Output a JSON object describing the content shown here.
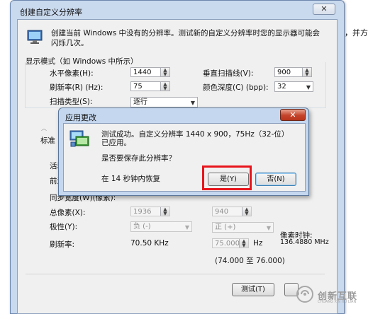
{
  "outer_window": {
    "title": "创建自定义分辨率",
    "close_label": "✕",
    "intro": "创建当前 Windows 中没有的分辨率。测试新的自定义分辨率时您的显示器可能会闪烁几次。",
    "display_mode_group": "显示模式（如 Windows 中所示）",
    "horizontal_pixels_label": "水平像素(H):",
    "horizontal_pixels_value": "1440",
    "vertical_lines_label": "垂直扫描线(V):",
    "vertical_lines_value": "900",
    "refresh_label": "刷新率(R) (Hz):",
    "refresh_value": "75",
    "color_depth_label": "颜色深度(C) (bpp):",
    "color_depth_value": "32",
    "scan_type_label": "扫描类型(S):",
    "scan_type_value": "逐行",
    "cut_left_1": "标准",
    "cut_left_2": "活动",
    "cut_left_3": "前沿",
    "cut_left_4": "同步宽度(W)(像素):",
    "total_pixels_label": "总像素(X):",
    "total_pixels_h": "1936",
    "total_pixels_v": "940",
    "polarity_label": "极性(Y):",
    "polarity_h": "负 (-)",
    "polarity_v": "正 (+)",
    "pixel_clock_label": "像素时钟:",
    "pixel_clock_value": "136.4880 MHz",
    "refresh2_label": "刷新率:",
    "refresh2_khz": "70.50 KHz",
    "refresh2_hz_value": "75.000",
    "refresh2_hz_unit": "Hz",
    "refresh_range": "(74.000 至 76.000)",
    "test_button": "测试(T)",
    "side_text": "，并方"
  },
  "popup": {
    "title": "应用更改",
    "close_label": "✕",
    "message": "测试成功。自定义分辨率 1440 x 900，75Hz（32-位）已应用。",
    "question": "是否要保存此分辨率？",
    "countdown": "在 14 秒钟内恢复",
    "yes_button": "是(Y)",
    "no_button": "否(N)"
  },
  "watermark": {
    "text": "创新互联",
    "sub": "CHUANG XIN HU LIAN"
  },
  "colors": {
    "highlight": "#e8141b",
    "window_frame": "#c9d9ee",
    "client_bg": "#f0f0f0"
  }
}
